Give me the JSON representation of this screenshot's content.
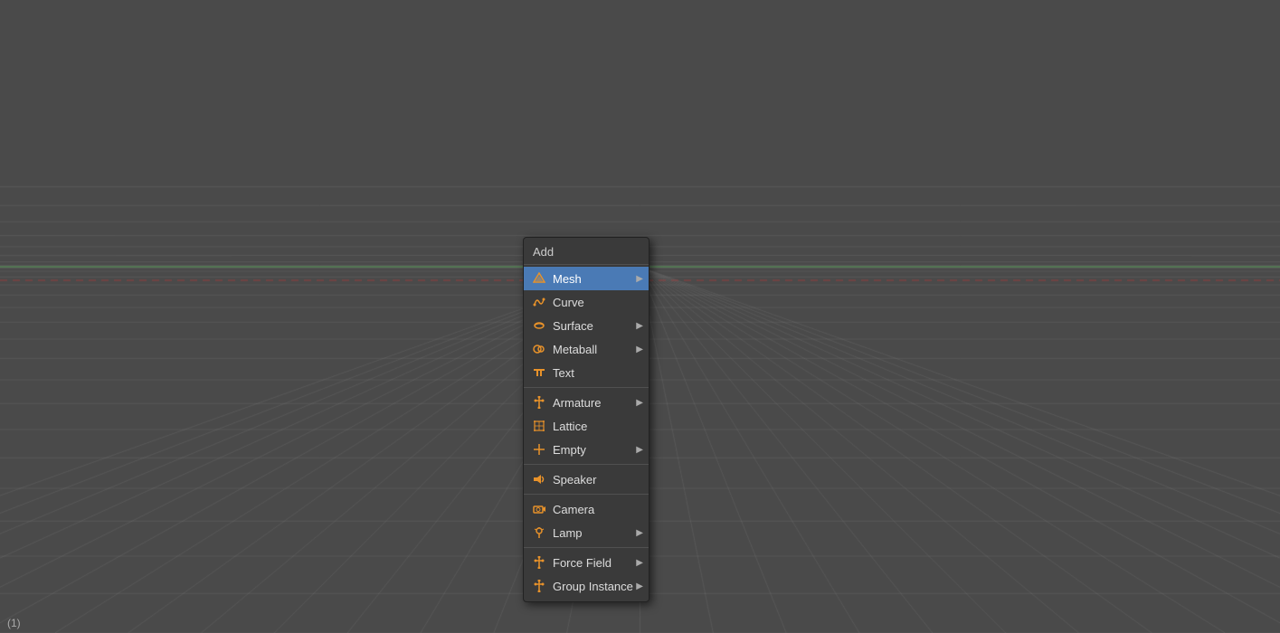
{
  "viewport": {
    "corner_label": "(1)"
  },
  "menu": {
    "title": "Add",
    "items": [
      {
        "id": "mesh",
        "label": "Mesh",
        "icon": "mesh",
        "has_arrow": true,
        "active": true,
        "separator_before": false
      },
      {
        "id": "curve",
        "label": "Curve",
        "icon": "curve",
        "has_arrow": false,
        "active": false,
        "separator_before": false
      },
      {
        "id": "surface",
        "label": "Surface",
        "icon": "surface",
        "has_arrow": true,
        "active": false,
        "separator_before": false
      },
      {
        "id": "metaball",
        "label": "Metaball",
        "icon": "metaball",
        "has_arrow": true,
        "active": false,
        "separator_before": false
      },
      {
        "id": "text",
        "label": "Text",
        "icon": "text",
        "has_arrow": false,
        "active": false,
        "separator_before": false
      },
      {
        "id": "armature",
        "label": "Armature",
        "icon": "armature",
        "has_arrow": true,
        "active": false,
        "separator_before": true
      },
      {
        "id": "lattice",
        "label": "Lattice",
        "icon": "lattice",
        "has_arrow": false,
        "active": false,
        "separator_before": false
      },
      {
        "id": "empty",
        "label": "Empty",
        "icon": "empty",
        "has_arrow": true,
        "active": false,
        "separator_before": false
      },
      {
        "id": "speaker",
        "label": "Speaker",
        "icon": "speaker",
        "has_arrow": false,
        "active": false,
        "separator_before": true
      },
      {
        "id": "camera",
        "label": "Camera",
        "icon": "camera",
        "has_arrow": false,
        "active": false,
        "separator_before": true
      },
      {
        "id": "lamp",
        "label": "Lamp",
        "icon": "lamp",
        "has_arrow": true,
        "active": false,
        "separator_before": false
      },
      {
        "id": "force-field",
        "label": "Force Field",
        "icon": "force-field",
        "has_arrow": true,
        "active": false,
        "separator_before": true
      },
      {
        "id": "group-instance",
        "label": "Group Instance",
        "icon": "group-instance",
        "has_arrow": true,
        "active": false,
        "separator_before": false
      }
    ]
  }
}
